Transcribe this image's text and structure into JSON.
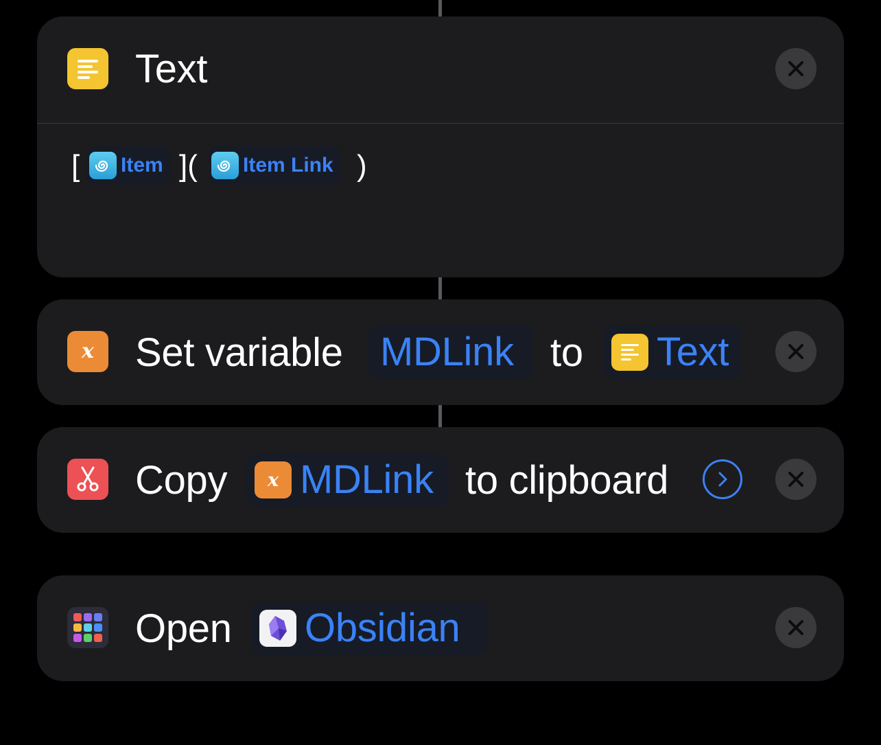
{
  "actions": {
    "text_action": {
      "title": "Text",
      "icon": "text-lines-icon",
      "content": {
        "open_bracket": "[",
        "token1": "Item",
        "mid": "](",
        "token2": "Item Link",
        "close_paren": ")"
      }
    },
    "set_variable": {
      "label": "Set variable",
      "variable": "MDLink",
      "to_label": "to",
      "value": "Text",
      "icon": "variable-x-icon"
    },
    "copy": {
      "label": "Copy",
      "variable": "MDLink",
      "to_label": "to clipboard",
      "icon": "scissors-icon"
    },
    "open": {
      "label": "Open",
      "app": "Obsidian",
      "icon": "app-grid-icon"
    }
  },
  "colors": {
    "accent": "#3b82f6",
    "card": "#1c1c1e",
    "background": "#000000"
  }
}
